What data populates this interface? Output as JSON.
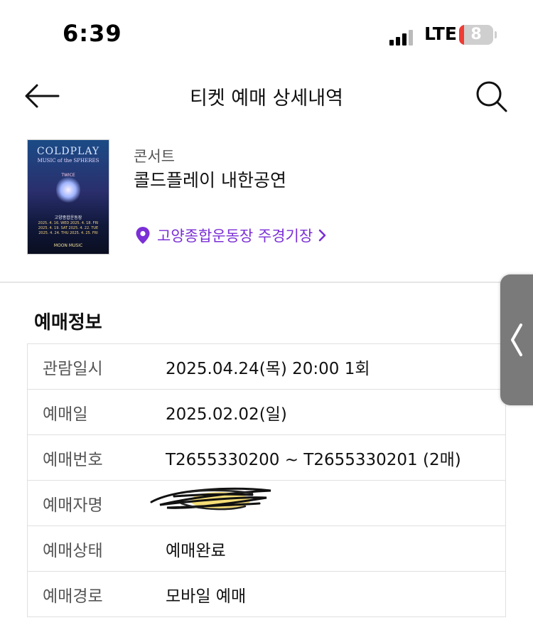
{
  "status_bar": {
    "time": "6:39",
    "carrier": "LTE",
    "battery": "8"
  },
  "header": {
    "title": "티켓 예매 상세내역"
  },
  "event": {
    "category": "콘서트",
    "title": "콜드플레이 내한공연",
    "venue": "고양종합운동장 주경기장",
    "poster": {
      "title": "COLDPLAY",
      "subtitle": "MUSIC of the SPHERES",
      "guest": "TWICE",
      "venue": "고양종합운동장",
      "dates": [
        "2025. 4. 16. WED 2025. 4. 18. FRI",
        "2025. 4. 19. SAT 2025. 4. 22. TUE",
        "2025. 4. 24. THU 2025. 4. 25. FRI"
      ],
      "footer": "MOON MUSIC"
    }
  },
  "booking_info": {
    "section_title": "예매정보",
    "rows": [
      {
        "label": "관람일시",
        "value": "2025.04.24(목) 20:00 1회"
      },
      {
        "label": "예매일",
        "value": "2025.02.02(일)"
      },
      {
        "label": "예매번호",
        "value": "T2655330200 ~ T2655330201 (2매)"
      },
      {
        "label": "예매자명",
        "value": ""
      },
      {
        "label": "예매상태",
        "value": "예매완료"
      },
      {
        "label": "예매경로",
        "value": "모바일 예매"
      }
    ]
  },
  "colors": {
    "accent": "#7b2fd6",
    "battery_low": "#ef3b34",
    "side_handle": "#7a7a7a"
  },
  "icons": {
    "back": "arrow-left-icon",
    "search": "search-icon",
    "venue": "location-pin-icon",
    "chevron": "chevron-right-icon",
    "handle": "chevron-left-icon"
  }
}
